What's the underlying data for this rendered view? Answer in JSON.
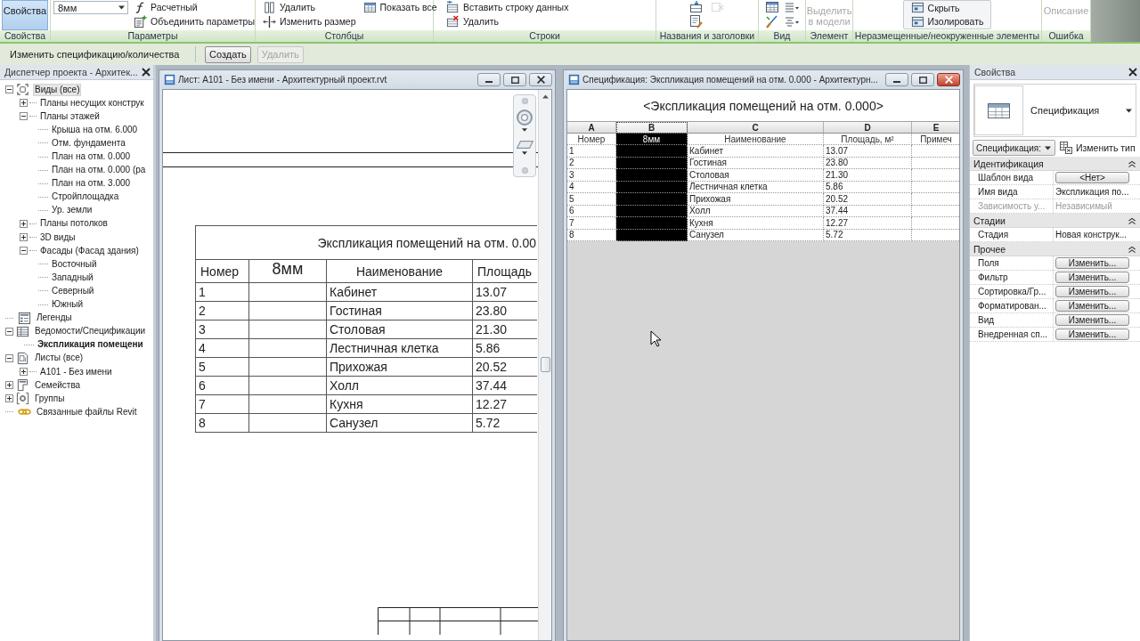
{
  "ribbon": {
    "panels": [
      {
        "label": "Свойства",
        "columns": [
          [
            {
              "kind": "large",
              "label": "Свойства",
              "on": true,
              "disabled": false
            }
          ]
        ]
      },
      {
        "label": "Параметры",
        "columns": [
          [
            {
              "kind": "dropdown",
              "label": "8мм",
              "disabled": false
            }
          ],
          [
            {
              "kind": "small",
              "label": "Расчетный",
              "disabled": false
            },
            {
              "kind": "small",
              "label": "Объединить параметры",
              "disabled": false
            }
          ]
        ]
      },
      {
        "label": "Столбцы",
        "columns": [
          [
            {
              "kind": "small",
              "label": "Удалить",
              "disabled": false
            },
            {
              "kind": "small",
              "label": "Изменить размер",
              "disabled": false
            }
          ],
          [
            {
              "kind": "small",
              "label": "Показать все",
              "disabled": false
            }
          ]
        ]
      },
      {
        "label": "Строки",
        "columns": [
          [
            {
              "kind": "small",
              "label": "Вставить строку данных",
              "disabled": false
            },
            {
              "kind": "small",
              "label": "Удалить",
              "disabled": false
            }
          ]
        ]
      },
      {
        "label": "Названия и заголовки",
        "columns": [
          [
            {
              "kind": "tool",
              "disabled": false
            },
            {
              "kind": "tool",
              "disabled": false
            }
          ],
          [
            {
              "kind": "tool",
              "disabled": true
            }
          ]
        ]
      },
      {
        "label": "Вид",
        "columns": [
          [
            {
              "kind": "tool",
              "disabled": false
            },
            {
              "kind": "tool",
              "disabled": false
            }
          ],
          [
            {
              "kind": "tool",
              "disabled": false
            },
            {
              "kind": "tool",
              "disabled": false
            }
          ]
        ]
      },
      {
        "label": "Элемент",
        "columns": [
          [
            {
              "kind": "large",
              "label": "Выделить в модели",
              "on": false,
              "disabled": true
            }
          ]
        ]
      },
      {
        "label": "Неразмещенные/неокруженные элементы",
        "columns": [
          [
            {
              "kind": "toggle",
              "label": "Скрыть",
              "disabled": false
            },
            {
              "kind": "toggle",
              "label": "Изолировать",
              "disabled": false
            }
          ]
        ]
      },
      {
        "label": "Ошибка",
        "columns": [
          [
            {
              "kind": "large",
              "label": "Описание",
              "on": false,
              "disabled": true
            }
          ]
        ]
      }
    ]
  },
  "options_bar": {
    "title": "Изменить спецификацию/количества",
    "buttons": [
      {
        "label": "Создать",
        "disabled": false
      },
      {
        "label": "Удалить",
        "disabled": true
      }
    ]
  },
  "browser": {
    "title": "Диспетчер проекта - Архитек...",
    "tree": [
      {
        "label": "Виды (все)",
        "expanded": true,
        "selected": true,
        "current": false,
        "children": [
          {
            "label": "Планы несущих конструк",
            "expanded": false,
            "selected": false,
            "current": false
          },
          {
            "label": "Планы этажей",
            "expanded": true,
            "selected": false,
            "current": false,
            "children": [
              {
                "label": "Крыша на отм. 6.000",
                "selected": false,
                "current": false
              },
              {
                "label": "Отм. фундамента",
                "selected": false,
                "current": false
              },
              {
                "label": "План на отм. 0.000",
                "selected": false,
                "current": false
              },
              {
                "label": "План на отм. 0.000 (ра",
                "selected": false,
                "current": false
              },
              {
                "label": "План на отм. 3.000",
                "selected": false,
                "current": false
              },
              {
                "label": "Стройплощадка",
                "selected": false,
                "current": false
              },
              {
                "label": "Ур. земли",
                "selected": false,
                "current": false
              }
            ]
          },
          {
            "label": "Планы потолков",
            "expanded": false,
            "selected": false,
            "current": false
          },
          {
            "label": "3D виды",
            "expanded": false,
            "selected": false,
            "current": false
          },
          {
            "label": "Фасады (Фасад здания)",
            "expanded": true,
            "selected": false,
            "current": false,
            "children": [
              {
                "label": "Восточный",
                "selected": false,
                "current": false
              },
              {
                "label": "Западный",
                "selected": false,
                "current": false
              },
              {
                "label": "Северный",
                "selected": false,
                "current": false
              },
              {
                "label": "Южный",
                "selected": false,
                "current": false
              }
            ]
          }
        ]
      },
      {
        "label": "Легенды",
        "selected": false,
        "current": false
      },
      {
        "label": "Ведомости/Спецификации",
        "expanded": true,
        "selected": false,
        "current": false,
        "children": [
          {
            "label": "Экспликация помещени",
            "selected": false,
            "current": true
          }
        ]
      },
      {
        "label": "Листы (все)",
        "expanded": true,
        "selected": false,
        "current": false,
        "children": [
          {
            "label": "A101 - Без имени",
            "expanded": false,
            "selected": false,
            "current": false
          }
        ]
      },
      {
        "label": "Семейства",
        "expanded": false,
        "selected": false,
        "current": false
      },
      {
        "label": "Группы",
        "expanded": false,
        "selected": false,
        "current": false
      },
      {
        "label": "Связанные файлы Revit",
        "selected": false,
        "current": false
      }
    ]
  },
  "sheet_window": {
    "title": "Лист: A101 - Без имени - Архитектурный проект.rvt",
    "active": false,
    "schedule": {
      "title": "Экспликация помещений на отм. 0.00",
      "columns": [
        "Номер",
        "8мм",
        "Наименование",
        "Площадь"
      ],
      "rows": [
        {
          "number": "1",
          "name": "Кабинет",
          "area": "13.07"
        },
        {
          "number": "2",
          "name": "Гостиная",
          "area": "23.80"
        },
        {
          "number": "3",
          "name": "Столовая",
          "area": "21.30"
        },
        {
          "number": "4",
          "name": "Лестничная клетка",
          "area": "5.86"
        },
        {
          "number": "5",
          "name": "Прихожая",
          "area": "20.52"
        },
        {
          "number": "6",
          "name": "Холл",
          "area": "37.44"
        },
        {
          "number": "7",
          "name": "Кухня",
          "area": "12.27"
        },
        {
          "number": "8",
          "name": "Санузел",
          "area": "5.72"
        }
      ]
    }
  },
  "schedule_window": {
    "title": "Спецификация: Экспликация помещений на отм. 0.000 - Архитектурн...",
    "active": true,
    "heading": "<Экспликация помещений на отм. 0.000>",
    "columns": [
      {
        "letter": "A",
        "heading": "Номер",
        "selected": false
      },
      {
        "letter": "B",
        "heading": "8мм",
        "selected": true
      },
      {
        "letter": "C",
        "heading": "Наименование",
        "selected": false
      },
      {
        "letter": "D",
        "heading": "Площадь, м²",
        "selected": false
      },
      {
        "letter": "E",
        "heading": "Примеч",
        "selected": false
      }
    ],
    "rows": [
      {
        "number": "1",
        "name": "Кабинет",
        "area": "13.07"
      },
      {
        "number": "2",
        "name": "Гостиная",
        "area": "23.80"
      },
      {
        "number": "3",
        "name": "Столовая",
        "area": "21.30"
      },
      {
        "number": "4",
        "name": "Лестничная клетка",
        "area": "5.86"
      },
      {
        "number": "5",
        "name": "Прихожая",
        "area": "20.52"
      },
      {
        "number": "6",
        "name": "Холл",
        "area": "37.44"
      },
      {
        "number": "7",
        "name": "Кухня",
        "area": "12.27"
      },
      {
        "number": "8",
        "name": "Санузел",
        "area": "5.72"
      }
    ]
  },
  "properties": {
    "title": "Свойства",
    "type": "Спецификация",
    "filter": "Спецификация:",
    "edit_type": "Изменить тип",
    "groups": [
      {
        "label": "Идентификация",
        "expanded": true,
        "rows": [
          {
            "kind": "button",
            "name": "Шаблон вида",
            "value": "<Нет>",
            "disabled": false
          },
          {
            "kind": "text",
            "name": "Имя вида",
            "value": "Экспликация по...",
            "disabled": false
          },
          {
            "kind": "text",
            "name": "Зависимость у...",
            "value": "Независимый",
            "disabled": true
          }
        ]
      },
      {
        "label": "Стадии",
        "expanded": true,
        "rows": [
          {
            "kind": "text",
            "name": "Стадия",
            "value": "Новая конструк...",
            "disabled": false
          }
        ]
      },
      {
        "label": "Прочее",
        "expanded": true,
        "rows": [
          {
            "kind": "button",
            "name": "Поля",
            "value": "Изменить...",
            "disabled": false
          },
          {
            "kind": "button",
            "name": "Фильтр",
            "value": "Изменить...",
            "disabled": false
          },
          {
            "kind": "button",
            "name": "Сортировка/Гр...",
            "value": "Изменить...",
            "disabled": false
          },
          {
            "kind": "button",
            "name": "Форматирован...",
            "value": "Изменить...",
            "disabled": false
          },
          {
            "kind": "button",
            "name": "Вид",
            "value": "Изменить...",
            "disabled": false
          },
          {
            "kind": "button",
            "name": "Внедренная сп...",
            "value": "Изменить...",
            "disabled": false
          }
        ]
      }
    ]
  }
}
